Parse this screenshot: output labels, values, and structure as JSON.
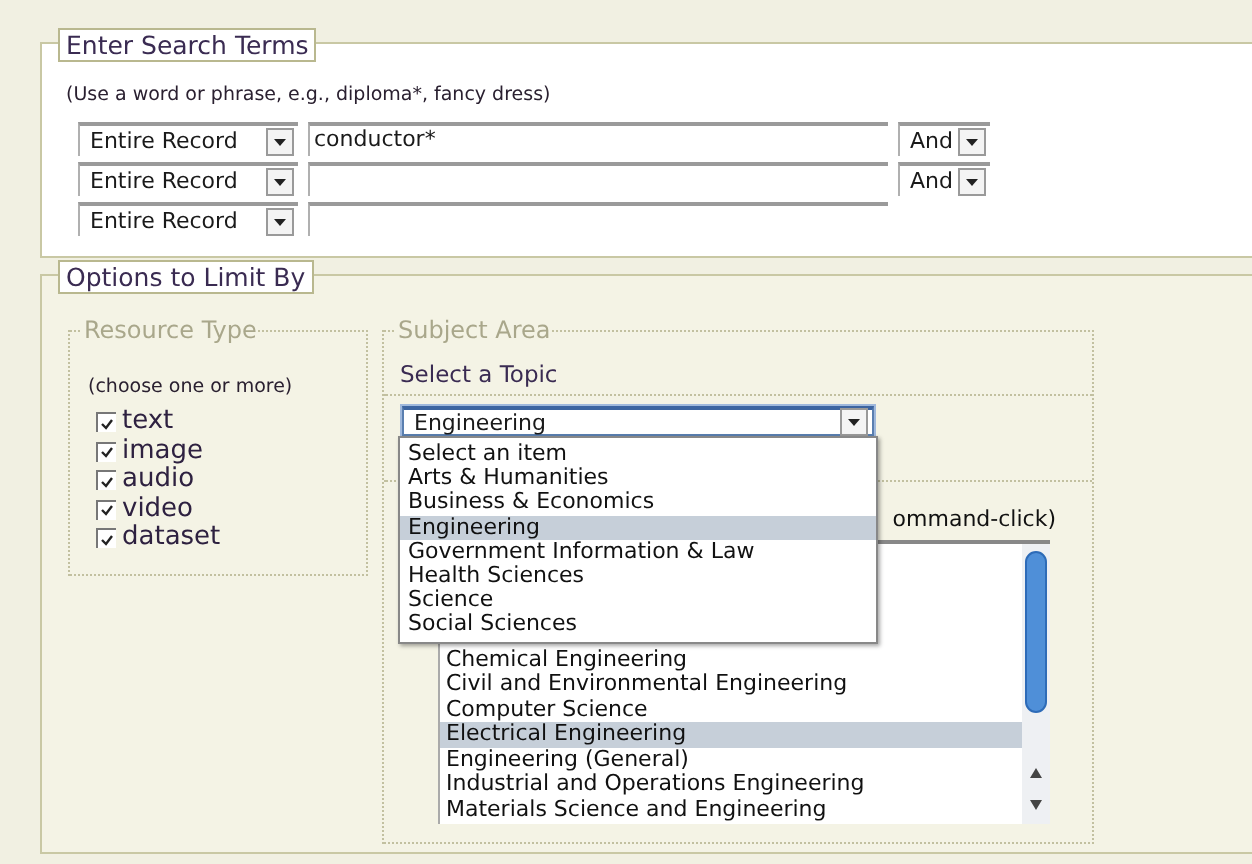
{
  "search_terms": {
    "legend": "Enter Search Terms",
    "hint": "(Use a word or phrase, e.g., diploma*, fancy dress)",
    "rows": [
      {
        "field": "Entire Record",
        "value": "conductor*",
        "operator": "And"
      },
      {
        "field": "Entire Record",
        "operator": "And"
      },
      {
        "field": "Entire Record"
      }
    ]
  },
  "limit_options": {
    "legend": "Options to Limit By",
    "resource_type": {
      "legend": "Resource Type",
      "hint": "(choose one or more)",
      "items": [
        {
          "label": "text",
          "checked": true
        },
        {
          "label": "image",
          "checked": true
        },
        {
          "label": "audio",
          "checked": true
        },
        {
          "label": "video",
          "checked": true
        },
        {
          "label": "dataset",
          "checked": true
        }
      ]
    },
    "subject_area": {
      "legend": "Subject Area",
      "topic_label": "Select a Topic",
      "topic_select": {
        "value": "Engineering",
        "expanded": true,
        "options": [
          {
            "label": "Select an item",
            "selected": false
          },
          {
            "label": "Arts & Humanities",
            "selected": false
          },
          {
            "label": "Business & Economics",
            "selected": false
          },
          {
            "label": "Engineering",
            "selected": true
          },
          {
            "label": "Government Information & Law",
            "selected": false
          },
          {
            "label": "Health Sciences",
            "selected": false
          },
          {
            "label": "Science",
            "selected": false
          },
          {
            "label": "Social Sciences",
            "selected": false
          }
        ]
      },
      "subtopic_hint": "ommand-click)",
      "subtopics": [
        {
          "label": "Chemical Engineering",
          "selected": false
        },
        {
          "label": "Civil and Environmental Engineering",
          "selected": false
        },
        {
          "label": "Computer Science",
          "selected": false
        },
        {
          "label": "Electrical Engineering",
          "selected": true
        },
        {
          "label": "Engineering (General)",
          "selected": false
        },
        {
          "label": "Industrial and Operations Engineering",
          "selected": false
        },
        {
          "label": "Materials Science and Engineering",
          "selected": false
        }
      ]
    }
  }
}
